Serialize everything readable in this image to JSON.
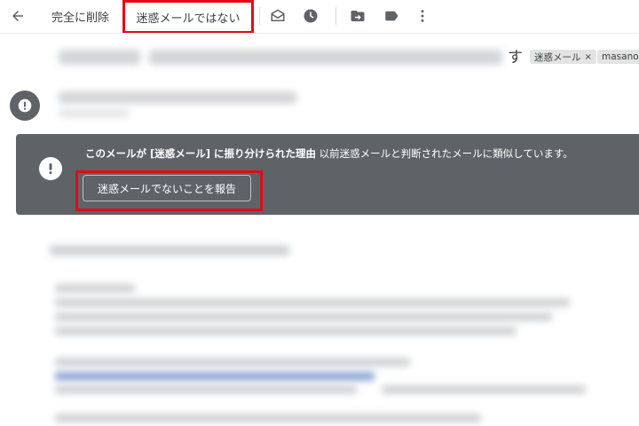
{
  "toolbar": {
    "back_icon": "arrow-back-icon",
    "delete_forever_label": "完全に削除",
    "not_spam_label": "迷惑メールではない",
    "icons": [
      "mark-unread-icon",
      "snooze-clock-icon",
      "move-to-icon",
      "label-icon",
      "more-vert-icon"
    ]
  },
  "email": {
    "subject_tail": "す",
    "labels": {
      "spam": "迷惑メール",
      "spam_remove": "×",
      "user": "masanob"
    },
    "sender_avatar_icon": "alert-icon"
  },
  "banner": {
    "icon": "alert-icon",
    "reason_label": "このメールが [迷惑メール] に振り分けられた理由",
    "reason_text": " 以前迷惑メールと判断されたメールに類似しています。",
    "report_button": "迷惑メールでないことを報告"
  },
  "colors": {
    "highlight": "#e10b17",
    "banner_bg": "#5f6368"
  }
}
